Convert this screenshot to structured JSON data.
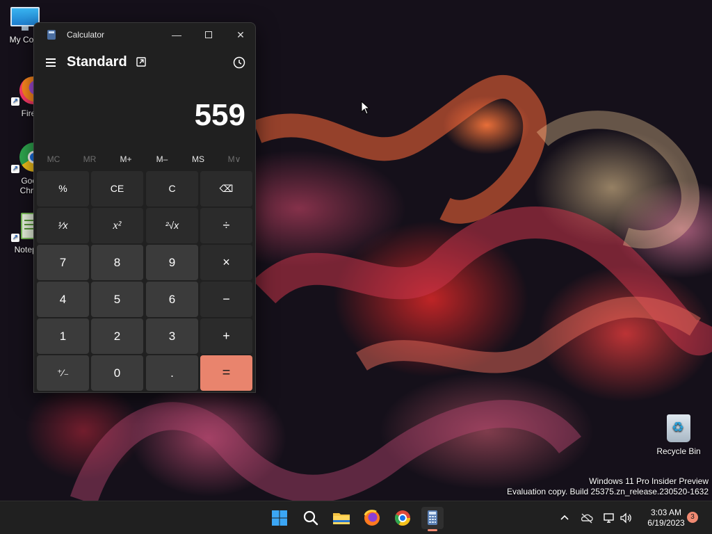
{
  "desktop": {
    "icons": [
      {
        "label": "My Com",
        "icon": "computer-icon"
      },
      {
        "label": "Firefo",
        "icon": "firefox-icon"
      },
      {
        "label": "Goog\nChron",
        "icon": "chrome-icon"
      },
      {
        "label": "Notepa",
        "icon": "notepad-icon"
      }
    ],
    "recycle_bin": {
      "label": "Recycle Bin",
      "icon": "recycle-bin-icon"
    },
    "watermark": {
      "line1": "Windows 11 Pro Insider Preview",
      "line2": "Evaluation copy. Build 25375.zn_release.230520-1632"
    }
  },
  "calculator": {
    "title": "Calculator",
    "mode": "Standard",
    "display": "559",
    "memory": [
      {
        "label": "MC",
        "enabled": false
      },
      {
        "label": "MR",
        "enabled": false
      },
      {
        "label": "M+",
        "enabled": true
      },
      {
        "label": "M–",
        "enabled": true
      },
      {
        "label": "MS",
        "enabled": true
      },
      {
        "label": "M∨",
        "enabled": false
      }
    ],
    "keys": {
      "percent": "%",
      "ce": "CE",
      "c": "C",
      "backspace": "⌫",
      "reciprocal": "¹⁄x",
      "square": "x²",
      "sqrt": "²√x",
      "divide": "÷",
      "n7": "7",
      "n8": "8",
      "n9": "9",
      "multiply": "×",
      "n4": "4",
      "n5": "5",
      "n6": "6",
      "subtract": "−",
      "n1": "1",
      "n2": "2",
      "n3": "3",
      "add": "+",
      "negate": "⁺⁄₋",
      "n0": "0",
      "decimal": ".",
      "equals": "="
    },
    "accent_color": "#e9846d"
  },
  "taskbar": {
    "apps": [
      {
        "name": "start",
        "icon": "windows-start-icon"
      },
      {
        "name": "search",
        "icon": "search-icon"
      },
      {
        "name": "file-explorer",
        "icon": "folder-icon"
      },
      {
        "name": "firefox",
        "icon": "firefox-icon"
      },
      {
        "name": "chrome",
        "icon": "chrome-icon"
      },
      {
        "name": "calculator",
        "icon": "calculator-icon",
        "active": true
      }
    ],
    "tray": {
      "time": "3:03 AM",
      "date": "6/19/2023",
      "notification_count": "3"
    }
  }
}
